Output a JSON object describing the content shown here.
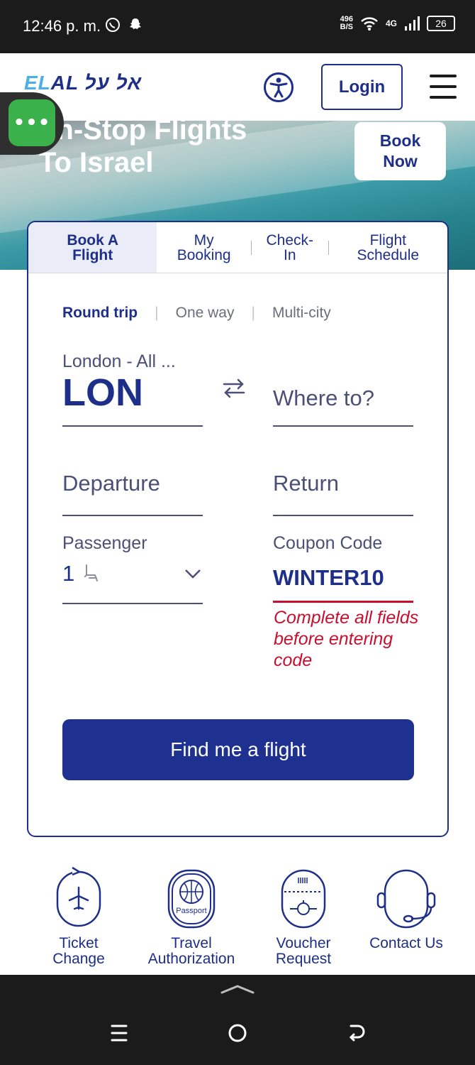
{
  "status_bar": {
    "time": "12:46 p. m.",
    "net_speed_value": "496",
    "net_speed_unit": "B/S",
    "network": "4G",
    "battery": "26"
  },
  "header": {
    "logo_latin": "EL",
    "logo_hebrew": "AL אל על",
    "login_label": "Login"
  },
  "hero": {
    "title_line1": "on-Stop Flights",
    "title_line2": "To Israel",
    "book_now_label": "Book Now"
  },
  "chat": {
    "label": "•••"
  },
  "tabs": [
    {
      "label": "Book A Flight",
      "active": true
    },
    {
      "label": "My Booking",
      "active": false
    },
    {
      "label": "Check-In",
      "active": false
    },
    {
      "label": "Flight Schedule",
      "active": false
    }
  ],
  "trip_types": {
    "round_trip": "Round trip",
    "one_way": "One way",
    "multi_city": "Multi-city"
  },
  "origin": {
    "city": "London - All ...",
    "code": "LON"
  },
  "destination": {
    "placeholder": "Where to?"
  },
  "departure": {
    "placeholder": "Departure"
  },
  "return_date": {
    "placeholder": "Return"
  },
  "passenger": {
    "label": "Passenger",
    "count": "1"
  },
  "coupon": {
    "label": "Coupon Code",
    "value": "WINTER10",
    "error": "Complete all fields before entering code"
  },
  "find_button": "Find me a flight",
  "quick_links": [
    {
      "label": "Ticket Change",
      "icon": "plane-refresh-icon"
    },
    {
      "label": "Travel Authorization",
      "icon": "passport-icon",
      "icon_text": "Passport"
    },
    {
      "label": "Voucher Request",
      "icon": "voucher-icon"
    },
    {
      "label": "Contact Us",
      "icon": "headset-icon"
    }
  ],
  "colors": {
    "brand_navy": "#1e2f8a",
    "brand_light_blue": "#4ab0e6",
    "error_red": "#c8102e",
    "chat_green": "#3ab14a"
  }
}
